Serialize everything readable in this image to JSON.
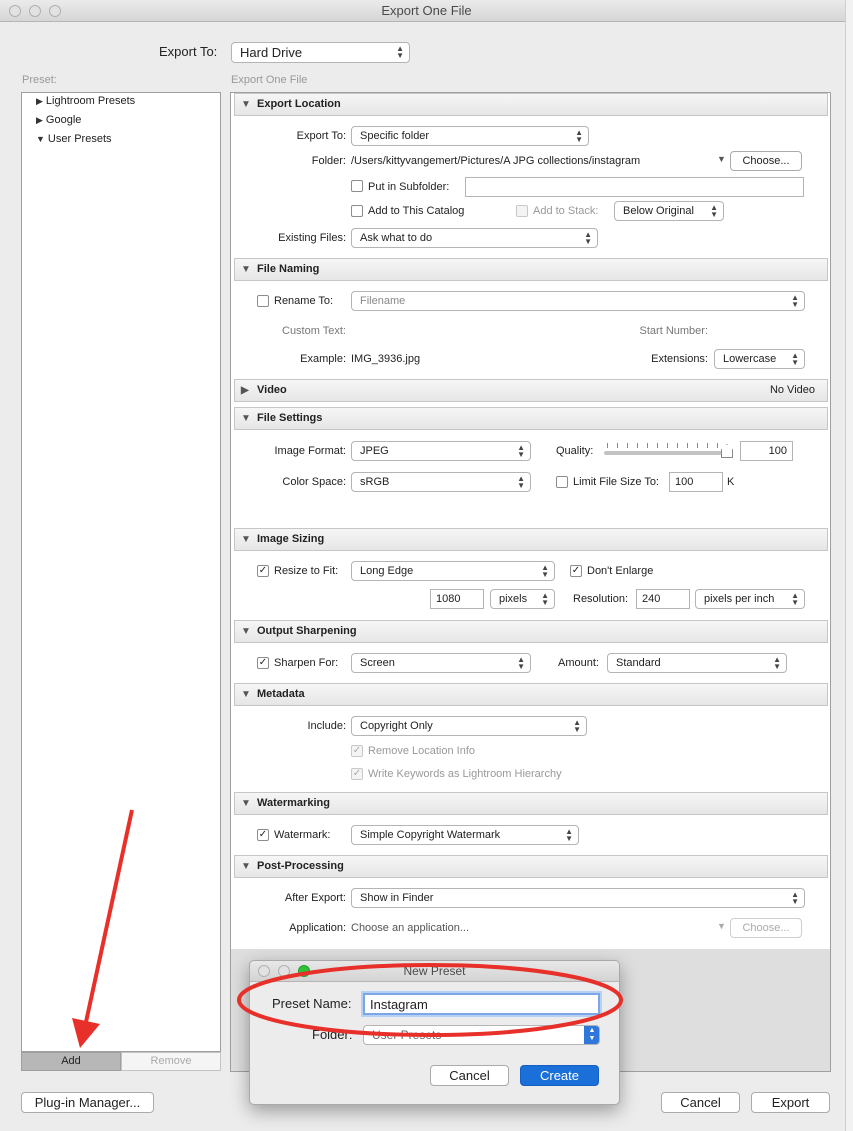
{
  "window": {
    "title": "Export One File"
  },
  "top": {
    "export_to_label": "Export To:",
    "export_to_value": "Hard Drive",
    "preset_label": "Preset:",
    "panel_caption": "Export One File"
  },
  "presets": {
    "items": [
      "Lightroom Presets",
      "Google",
      "User Presets"
    ],
    "add": "Add",
    "remove": "Remove"
  },
  "export_location": {
    "title": "Export Location",
    "export_to_label": "Export To:",
    "export_to_value": "Specific folder",
    "folder_label": "Folder:",
    "folder_path": "/Users/kittyvangemert/Pictures/A JPG collections/instagram",
    "choose": "Choose...",
    "subfolder_label": "Put in Subfolder:",
    "subfolder_value": "",
    "add_catalog_label": "Add to This Catalog",
    "add_stack_label": "Add to Stack:",
    "stack_value": "Below Original",
    "existing_label": "Existing Files:",
    "existing_value": "Ask what to do"
  },
  "file_naming": {
    "title": "File Naming",
    "rename_label": "Rename To:",
    "rename_value": "Filename",
    "custom_text_label": "Custom Text:",
    "start_number_label": "Start Number:",
    "example_label": "Example:",
    "example_value": "IMG_3936.jpg",
    "extensions_label": "Extensions:",
    "extensions_value": "Lowercase"
  },
  "video": {
    "title": "Video",
    "status": "No Video"
  },
  "file_settings": {
    "title": "File Settings",
    "format_label": "Image Format:",
    "format_value": "JPEG",
    "quality_label": "Quality:",
    "quality_value": "100",
    "color_label": "Color Space:",
    "color_value": "sRGB",
    "limit_label": "Limit File Size To:",
    "limit_value": "100",
    "limit_unit": "K"
  },
  "image_sizing": {
    "title": "Image Sizing",
    "resize_label": "Resize to Fit:",
    "resize_value": "Long Edge",
    "dont_enlarge_label": "Don't Enlarge",
    "size_value": "1080",
    "size_unit": "pixels",
    "resolution_label": "Resolution:",
    "resolution_value": "240",
    "resolution_unit": "pixels per inch"
  },
  "output_sharpening": {
    "title": "Output Sharpening",
    "sharpen_label": "Sharpen For:",
    "sharpen_value": "Screen",
    "amount_label": "Amount:",
    "amount_value": "Standard"
  },
  "metadata": {
    "title": "Metadata",
    "include_label": "Include:",
    "include_value": "Copyright Only",
    "remove_location_label": "Remove Location Info",
    "keywords_label": "Write Keywords as Lightroom Hierarchy"
  },
  "watermarking": {
    "title": "Watermarking",
    "watermark_label": "Watermark:",
    "watermark_value": "Simple Copyright Watermark"
  },
  "post_processing": {
    "title": "Post-Processing",
    "after_label": "After Export:",
    "after_value": "Show in Finder",
    "app_label": "Application:",
    "app_value": "Choose an application...",
    "choose": "Choose..."
  },
  "bottom": {
    "plugin_manager": "Plug-in Manager...",
    "cancel": "Cancel",
    "export": "Export"
  },
  "new_preset": {
    "title": "New Preset",
    "name_label": "Preset Name:",
    "name_value": "Instagram",
    "folder_label": "Folder:",
    "folder_value": "User Presets",
    "cancel": "Cancel",
    "create": "Create"
  },
  "colors": {
    "annotation": "#e8302a",
    "primary_button": "#1a6fd8"
  }
}
